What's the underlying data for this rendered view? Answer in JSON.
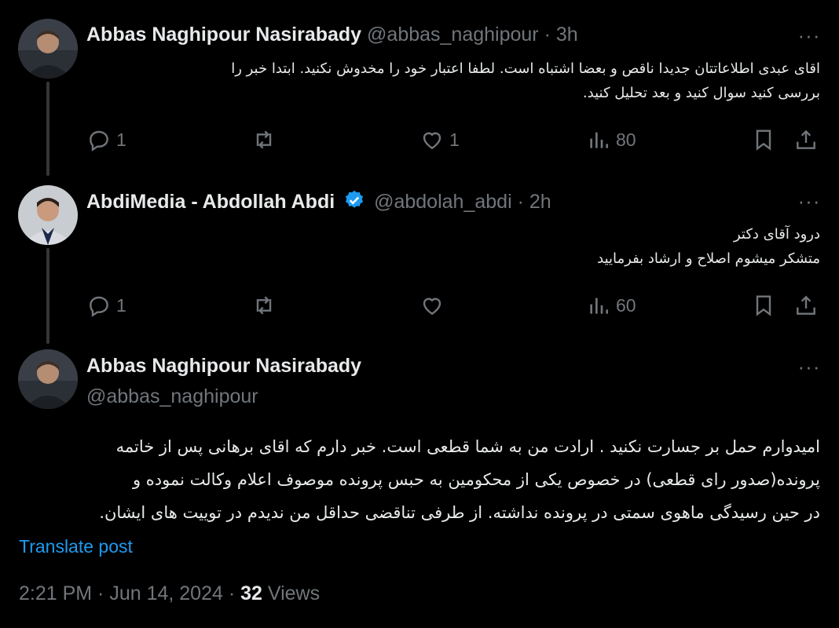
{
  "tweets": [
    {
      "name": "Abbas Naghipour Nasirabady",
      "handle": "@abbas_naghipour",
      "time": "· 3h",
      "lines": [
        "اقای عبدی اطلاعاتتان جدیدا ناقص و بعضا اشتباه است. لطفا اعتبار خود را مخدوش نکنید. ابتدا خبر را",
        "بررسی کنید سوال کنید و بعد تحلیل کنید."
      ],
      "replies": "1",
      "reposts": "",
      "likes": "1",
      "views": "80"
    },
    {
      "name": "AbdiMedia - Abdollah Abdi",
      "handle": "@abdolah_abdi",
      "time": "· 2h",
      "lines": [
        "درود آقای دکتر",
        "متشکر میشوم اصلاح و ارشاد بفرمایید"
      ],
      "replies": "1",
      "reposts": "",
      "likes": "",
      "views": "60"
    },
    {
      "name": "Abbas Naghipour Nasirabady",
      "handle": "@abbas_naghipour",
      "lines": [
        "امیدوارم حمل بر جسارت نکنید . ارادت من به شما قطعی است. خبر دارم که اقای برهانی پس از خاتمه",
        "پرونده(صدور رای قطعی) در خصوص یکی از محکومین به حبس پرونده موصوف  اعلام وکالت نموده و",
        "در حین رسیدگی ماهوی سمتی در پرونده نداشته. از طرفی تناقضی حداقل من ندیدم در توییت های ایشان."
      ],
      "translate": "Translate post",
      "timestamp": "2:21 PM · Jun 14, 2024 · ",
      "views_count": "32",
      "views_label": " Views"
    }
  ],
  "colors": {
    "accent": "#1d9bf0",
    "muted": "#71767b",
    "text": "#e7e9ea",
    "background": "#000000"
  },
  "icons": [
    "more-icon",
    "verified-badge-icon",
    "reply-icon",
    "repost-icon",
    "like-icon",
    "views-icon",
    "bookmark-icon",
    "share-icon"
  ]
}
